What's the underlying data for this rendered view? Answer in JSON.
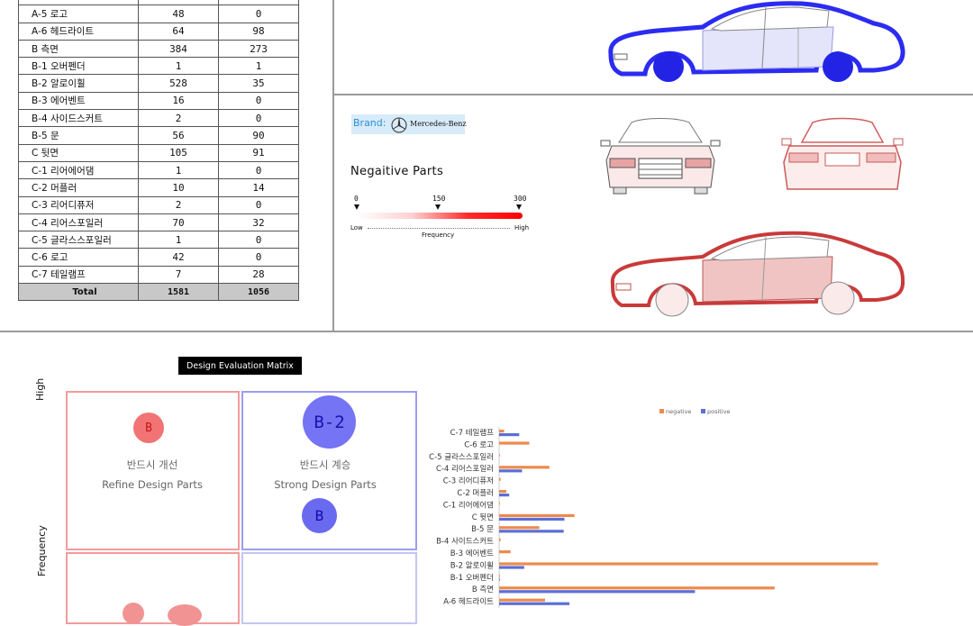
{
  "table": {
    "rows": [
      {
        "label": "A-5 로고",
        "neg": "48",
        "pos": "0"
      },
      {
        "label": "A-6 헤드라이트",
        "neg": "64",
        "pos": "98"
      },
      {
        "label": "B 측면",
        "neg": "384",
        "pos": "273"
      },
      {
        "label": "B-1 오버펜더",
        "neg": "1",
        "pos": "1"
      },
      {
        "label": "B-2 알로이휠",
        "neg": "528",
        "pos": "35"
      },
      {
        "label": "B-3 에어벤트",
        "neg": "16",
        "pos": "0"
      },
      {
        "label": "B-4 사이드스커트",
        "neg": "2",
        "pos": "0"
      },
      {
        "label": "B-5 문",
        "neg": "56",
        "pos": "90"
      },
      {
        "label": "C 뒷면",
        "neg": "105",
        "pos": "91"
      },
      {
        "label": "C-1 리어에어댐",
        "neg": "1",
        "pos": "0"
      },
      {
        "label": "C-2 머플러",
        "neg": "10",
        "pos": "14"
      },
      {
        "label": "C-3 리어디퓨저",
        "neg": "2",
        "pos": "0"
      },
      {
        "label": "C-4 리어스포일러",
        "neg": "70",
        "pos": "32"
      },
      {
        "label": "C-5 글라스스포일러",
        "neg": "1",
        "pos": "0"
      },
      {
        "label": "C-6 로고",
        "neg": "42",
        "pos": "0"
      },
      {
        "label": "C-7 테일램프",
        "neg": "7",
        "pos": "28"
      }
    ],
    "total": {
      "label": "Total",
      "neg": "1581",
      "pos": "1056"
    }
  },
  "brand": {
    "label": "Brand:",
    "name": "Mercedes-Benz"
  },
  "legend": {
    "title": "Negaitive Parts",
    "ticks": [
      "0",
      "150",
      "300"
    ],
    "low": "Low",
    "high": "High",
    "axis": "Frequency"
  },
  "matrix": {
    "title": "Design Evaluation Matrix",
    "y_high": "High",
    "y_axis": "Frequency",
    "q1_kr": "반드시 개선",
    "q1_en": "Refine Design Parts",
    "q2_kr": "반드시 계승",
    "q2_en": "Strong Design Parts",
    "bubble_b_red": "B",
    "bubble_b2": "B-2",
    "bubble_b_blue": "B"
  },
  "colors": {
    "negative": "#ed8a4d",
    "positive": "#5b6fd6",
    "red": "#e23b3b",
    "blue": "#2323e6"
  },
  "chart_data": {
    "type": "bar",
    "orientation": "horizontal",
    "legend_position": "top",
    "categories": [
      "C-7 테일램프",
      "C-6 로고",
      "C-5 글라스스포일러",
      "C-4 리어스포일러",
      "C-3 리어디퓨저",
      "C-2 머플러",
      "C-1 리어에어댐",
      "C 뒷면",
      "B-5 문",
      "B-4 사이드스커트",
      "B-3 에어벤트",
      "B-2 알로이휠",
      "B-1 오버펜더",
      "B 측면",
      "A-6 헤드라이트"
    ],
    "series": [
      {
        "name": "negative",
        "values": [
          7,
          42,
          1,
          70,
          2,
          10,
          1,
          105,
          56,
          2,
          16,
          528,
          1,
          384,
          64
        ]
      },
      {
        "name": "positive",
        "values": [
          28,
          0,
          0,
          32,
          0,
          14,
          0,
          91,
          90,
          0,
          0,
          35,
          1,
          273,
          98
        ]
      }
    ],
    "xlim": [
      0,
      560
    ]
  }
}
